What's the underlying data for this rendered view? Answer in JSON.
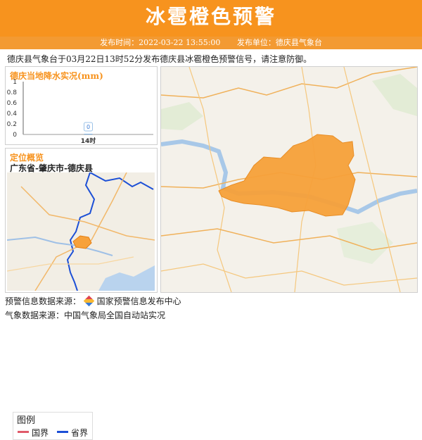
{
  "header": {
    "title": "冰雹橙色预警"
  },
  "subbar": {
    "time_label": "发布时间：2022-03-22 13:55:00",
    "unit_label": "发布单位：德庆县气象台"
  },
  "notice": "德庆县气象台于03月22日13时52分发布德庆县冰雹橙色预警信号，请注意防御。",
  "rain_panel": {
    "title": "德庆当地降水实况(mm)",
    "chart_data": {
      "type": "bar",
      "categories": [
        "14时"
      ],
      "values": [
        0
      ],
      "data_labels": [
        "0"
      ],
      "yticks": [
        "1",
        "0.8",
        "0.6",
        "0.4",
        "0.2",
        "0"
      ],
      "ylim": [
        0,
        1
      ],
      "grid": false
    }
  },
  "location": {
    "title": "定位概览",
    "name": "广东省-肇庆市-德庆县"
  },
  "legend": {
    "title": "图例",
    "items": [
      {
        "label": "国界",
        "color": "#e05a6a"
      },
      {
        "label": "省界",
        "color": "#1c4fd6"
      }
    ]
  },
  "footer": {
    "warning_source": "预警信息数据来源：",
    "warning_source_name": "国家预警信息发布中心",
    "weather_source": "气象数据来源：中国气象局全国自动站实况"
  },
  "colors": {
    "accent": "#f7931e",
    "warning_area": "#f7a13a"
  }
}
